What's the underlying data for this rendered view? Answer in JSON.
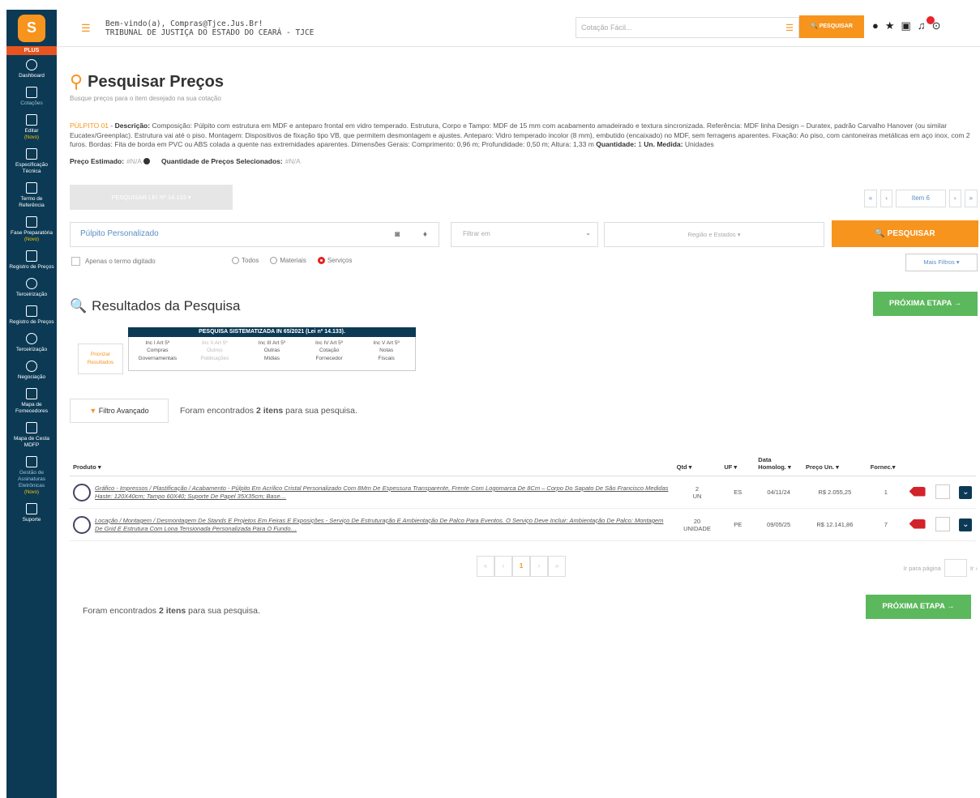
{
  "sidebar": {
    "logo_text": "S",
    "plus_label": "PLUS",
    "items": [
      {
        "label": "Dashboard",
        "sub": ""
      },
      {
        "label": "",
        "sub": "Cotações"
      },
      {
        "label": "Editar",
        "sub": "(Novo)"
      },
      {
        "label": "Especificação Técnica",
        "sub": ""
      },
      {
        "label": "Termo de Referência",
        "sub": ""
      },
      {
        "label": "Fase Preparatória",
        "sub": "(Novo)"
      },
      {
        "label": "Registro de Preços",
        "sub": ""
      },
      {
        "label": "Terceirização",
        "sub": ""
      },
      {
        "label": "Registro de Preços",
        "sub": ""
      },
      {
        "label": "Terceirização",
        "sub": ""
      },
      {
        "label": "Negociação",
        "sub": ""
      },
      {
        "label": "Mapa de Fornecedores",
        "sub": ""
      },
      {
        "label": "Mapa de Cesta MDFP",
        "sub": ""
      },
      {
        "label": "Gestão de Assinaturas Eletrônicas",
        "sub": "(Novo)"
      },
      {
        "label": "Suporte",
        "sub": ""
      }
    ]
  },
  "topbar": {
    "welcome_line1": "Bem-vindo(a), Compras@Tjce.Jus.Br!",
    "welcome_line2": "TRIBUNAL DE JUSTIÇA DO ESTADO DO CEARÁ - TJCE",
    "search_placeholder": "Cotação Fácil...",
    "search_button": "PESQUISAR"
  },
  "page": {
    "title": "Pesquisar Preços",
    "subtitle": "Busque preços para o item desejado na sua cotação"
  },
  "item": {
    "code": "PÚLPITO 01",
    "desc_label": "Descrição:",
    "description": "Composição: Púlpito com estrutura em MDF e anteparo frontal em vidro temperado. Estrutura, Corpo e Tampo: MDF de 15 mm com acabamento amadeirado e textura sincronizada. Referência: MDF linha Design – Duratex, padrão Carvalho Hanover (ou similar Eucatex/Greenplac). Estrutura vai até o piso. Montagem: Dispositivos de fixação tipo VB, que permitem desmontagem e ajustes. Anteparo: Vidro temperado incolor (8 mm), embutido (encaixado) no MDF, sem ferragens aparentes. Fixação: Ao piso, com cantoneiras metálicas em aço inox, com 2 furos. Bordas: Fita de borda em PVC ou ABS colada a quente nas extremidades aparentes. Dimensões Gerais: Comprimento: 0,96 m; Profundidade: 0,50 m; Altura: 1,33 m",
    "qty_label": "Quantidade:",
    "qty": "1",
    "unit_label": "Un. Medida:",
    "unit": "Unidades",
    "price_label": "Preço Estimado:",
    "price_value": "#N/A",
    "selected_label": "Quantidade de Preços Selecionados:",
    "selected_value": "#N/A"
  },
  "pager_top": {
    "first": "«",
    "prev": "‹",
    "label": "Item 6",
    "next": "›",
    "last": "»"
  },
  "gray_button": "PESQUISAR LEI Nº 14.133 ▾",
  "search": {
    "query": "Púlpito Personalizado",
    "filter_placeholder": "Filtrar em",
    "region_placeholder": "Região e Estados ▾",
    "button": "PESQUISAR",
    "exact_term": "Apenas o termo digitado",
    "radio_all": "Todos",
    "radio_materials": "Materiais",
    "radio_services": "Serviços",
    "more_filters": "Mais Filtros ▾"
  },
  "results": {
    "title": "Resultados da Pesquisa",
    "next_step": "PRÓXIMA ETAPA →",
    "prioritize": "Priorizar Resultados",
    "sys_title": "PESQUISA SISTEMATIZADA IN 65/2021 (Lei nº 14.133).",
    "sys_cols": [
      {
        "l1": "Inc I Art 5º",
        "l2": "Compras",
        "l3": "Governamentais",
        "dim": false
      },
      {
        "l1": "Inc II Art 5º",
        "l2": "Outros",
        "l3": "Publicações",
        "dim": true
      },
      {
        "l1": "Inc III Art 5º",
        "l2": "Outras",
        "l3": "Mídias",
        "dim": false
      },
      {
        "l1": "Inc IV Art 5º",
        "l2": "Cotação",
        "l3": "Fornecedor",
        "dim": false
      },
      {
        "l1": "Inc V Art 5º",
        "l2": "Notas",
        "l3": "Fiscais",
        "dim": false
      }
    ],
    "adv_filter": "Filtro Avançado",
    "found_prefix": "Foram encontrados",
    "found_count": "2 itens",
    "found_suffix": "para sua pesquisa.",
    "columns": {
      "product": "Produto ▾",
      "qty": "Qtd ▾",
      "uf": "UF ▾",
      "date": "Data Homolog. ▾",
      "price": "Preço Un. ▾",
      "supplier": "Fornec.▾"
    },
    "rows": [
      {
        "product": "Gráfico - Impressos / Plastificação / Acabamento - Púlpito Em Acrílico Cristal Personalizado Com 8Mm De Espessura Transparente, Frente Com Logomarca De 8Cm – Corpo Do Sapato De São Francisco Medidas Haste: 120X40cm; Tampo 60X40; Suporte De Papel 35X35cm; Base…",
        "qty": "2",
        "unit": "UN",
        "uf": "ES",
        "date": "04/11/24",
        "price": "R$ 2.055,25",
        "supplier": "1"
      },
      {
        "product": "Locação / Montagem / Desmontagem De Stands E Projetos Em Feiras E Exposições - Serviço De Estruturação E Ambientação De Palco Para Eventos. O Serviço Deve Incluir: Ambientação De Palco: Montagem De Grid E Estrutura Com Lona Tensionada Personalizada Para O Fundo…",
        "qty": "20",
        "unit": "UNIDADE",
        "uf": "PE",
        "date": "09/05/25",
        "price": "R$ 12.141,86",
        "supplier": "7"
      }
    ],
    "pages": [
      "«",
      "‹",
      "1",
      "›",
      "»"
    ],
    "goto_label": "Ir para página",
    "goto_button": "Ir ›"
  }
}
